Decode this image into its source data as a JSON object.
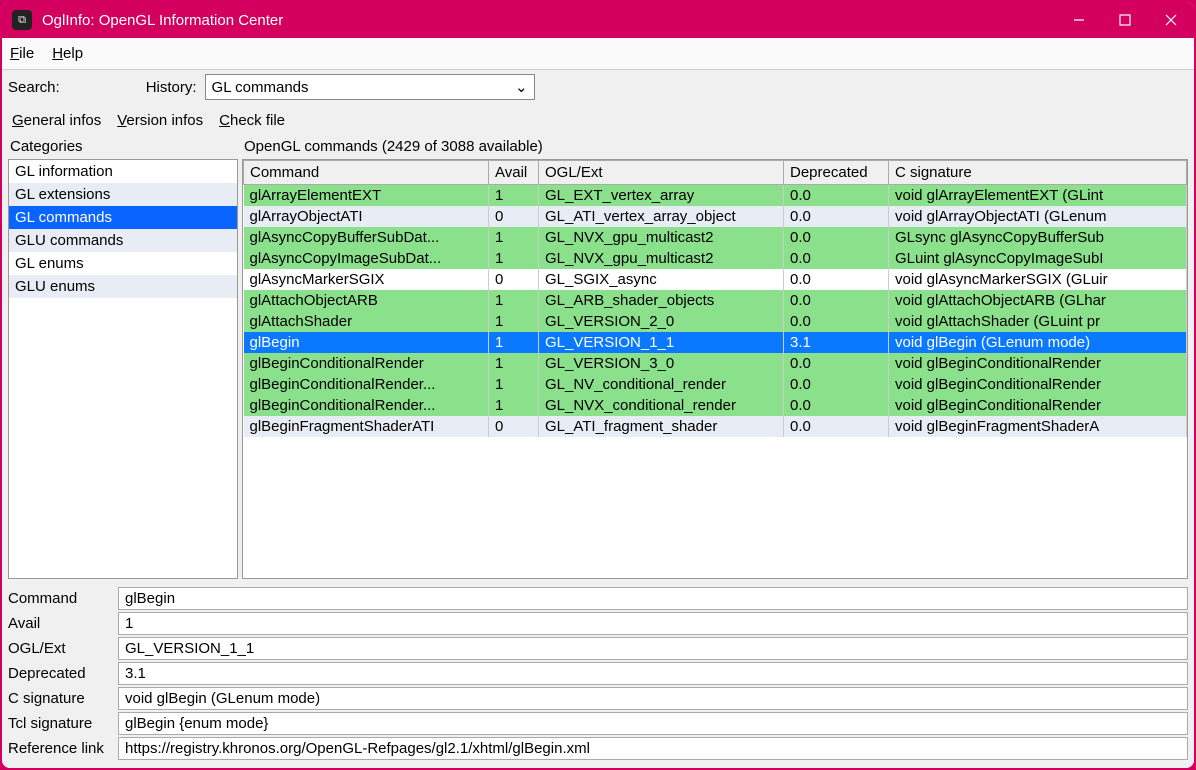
{
  "window": {
    "title": "OglInfo: OpenGL Information Center"
  },
  "menubar": {
    "file": "File",
    "help": "Help"
  },
  "search": {
    "label": "Search:",
    "history_label": "History:",
    "history_value": "GL commands"
  },
  "tabs": {
    "general": "General infos",
    "version": "Version infos",
    "check": "Check file"
  },
  "categories": {
    "header": "Categories",
    "items": [
      "GL information",
      "GL extensions",
      "GL commands",
      "GLU commands",
      "GL enums",
      "GLU enums"
    ],
    "selected_index": 2
  },
  "main": {
    "header": "OpenGL commands (2429 of 3088 available)",
    "columns": [
      "Command",
      "Avail",
      "OGL/Ext",
      "Deprecated",
      "C signature"
    ],
    "rows": [
      {
        "cmd": "glArrayElementEXT",
        "avail": "1",
        "ogl": "GL_EXT_vertex_array",
        "dep": "0.0",
        "sig": "void glArrayElementEXT (GLint",
        "cls": "avail"
      },
      {
        "cmd": "glArrayObjectATI",
        "avail": "0",
        "ogl": "GL_ATI_vertex_array_object",
        "dep": "0.0",
        "sig": "void glArrayObjectATI (GLenum",
        "cls": "unavail alt"
      },
      {
        "cmd": "glAsyncCopyBufferSubDat...",
        "avail": "1",
        "ogl": "GL_NVX_gpu_multicast2",
        "dep": "0.0",
        "sig": "GLsync glAsyncCopyBufferSub",
        "cls": "avail"
      },
      {
        "cmd": "glAsyncCopyImageSubDat...",
        "avail": "1",
        "ogl": "GL_NVX_gpu_multicast2",
        "dep": "0.0",
        "sig": "GLuint glAsyncCopyImageSubI",
        "cls": "avail"
      },
      {
        "cmd": "glAsyncMarkerSGIX",
        "avail": "0",
        "ogl": "GL_SGIX_async",
        "dep": "0.0",
        "sig": "void glAsyncMarkerSGIX (GLuir",
        "cls": "unavail"
      },
      {
        "cmd": "glAttachObjectARB",
        "avail": "1",
        "ogl": "GL_ARB_shader_objects",
        "dep": "0.0",
        "sig": "void glAttachObjectARB (GLhar",
        "cls": "avail"
      },
      {
        "cmd": "glAttachShader",
        "avail": "1",
        "ogl": "GL_VERSION_2_0",
        "dep": "0.0",
        "sig": "void glAttachShader (GLuint pr",
        "cls": "avail"
      },
      {
        "cmd": "glBegin",
        "avail": "1",
        "ogl": "GL_VERSION_1_1",
        "dep": "3.1",
        "sig": "void  glBegin (GLenum mode)",
        "cls": "selected"
      },
      {
        "cmd": "glBeginConditionalRender",
        "avail": "1",
        "ogl": "GL_VERSION_3_0",
        "dep": "0.0",
        "sig": "void glBeginConditionalRender",
        "cls": "avail"
      },
      {
        "cmd": "glBeginConditionalRender...",
        "avail": "1",
        "ogl": "GL_NV_conditional_render",
        "dep": "0.0",
        "sig": "void glBeginConditionalRender",
        "cls": "avail"
      },
      {
        "cmd": "glBeginConditionalRender...",
        "avail": "1",
        "ogl": "GL_NVX_conditional_render",
        "dep": "0.0",
        "sig": "void glBeginConditionalRender",
        "cls": "avail"
      },
      {
        "cmd": "glBeginFragmentShaderATI",
        "avail": "0",
        "ogl": "GL_ATI_fragment_shader",
        "dep": "0.0",
        "sig": "void glBeginFragmentShaderA",
        "cls": "partial"
      }
    ]
  },
  "details": {
    "rows": [
      {
        "label": "Command",
        "value": "glBegin"
      },
      {
        "label": "Avail",
        "value": "1"
      },
      {
        "label": "OGL/Ext",
        "value": "GL_VERSION_1_1"
      },
      {
        "label": "Deprecated",
        "value": "3.1"
      },
      {
        "label": "C signature",
        "value": "void  glBegin (GLenum mode)"
      },
      {
        "label": "Tcl signature",
        "value": "glBegin {enum mode}"
      },
      {
        "label": "Reference link",
        "value": "https://registry.khronos.org/OpenGL-Refpages/gl2.1/xhtml/glBegin.xml"
      }
    ]
  }
}
